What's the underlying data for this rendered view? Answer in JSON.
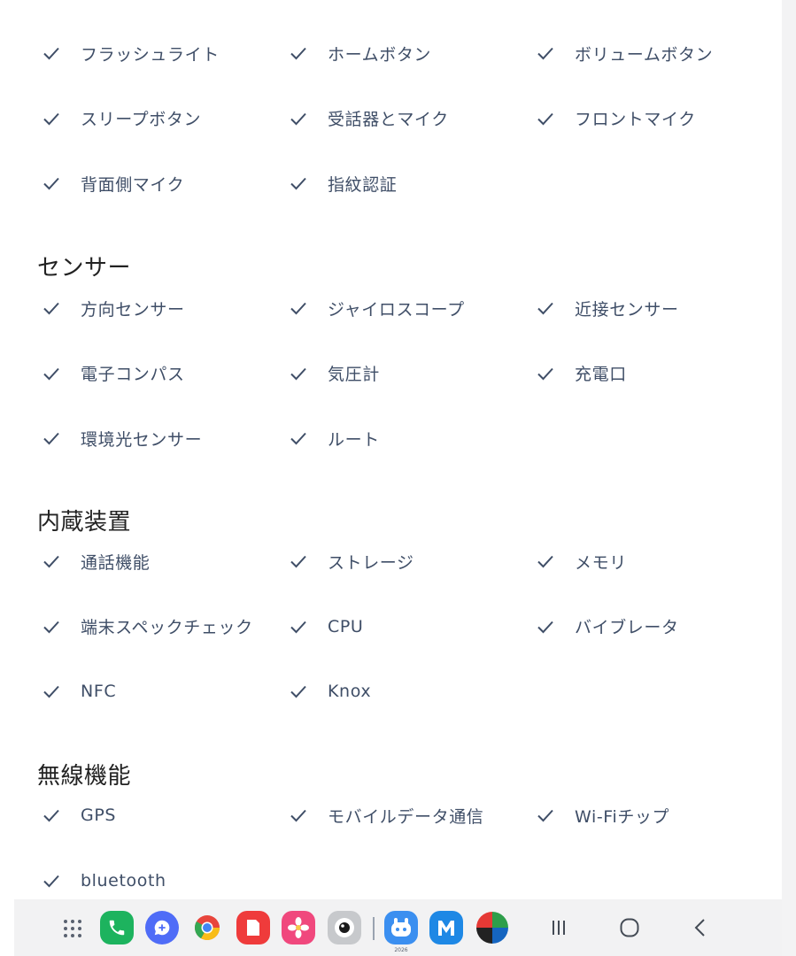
{
  "colors": {
    "accent": "#3f4e67",
    "heading": "#222222",
    "dock_bg": "#f2f2f3"
  },
  "sections": [
    {
      "title": "",
      "items": [
        "フラッシュライト",
        "ホームボタン",
        "ボリュームボタン",
        "スリープボタン",
        "受話器とマイク",
        "フロントマイク",
        "背面側マイク",
        "指紋認証"
      ]
    },
    {
      "title": "センサー",
      "items": [
        "方向センサー",
        "ジャイロスコープ",
        "近接センサー",
        "電子コンパス",
        "気圧計",
        "充電口",
        "環境光センサー",
        "ルート"
      ]
    },
    {
      "title": "内蔵装置",
      "items": [
        "通話機能",
        "ストレージ",
        "メモリ",
        "端末スペックチェック",
        "CPU",
        "バイブレータ",
        "NFC",
        "Knox"
      ]
    },
    {
      "title": "無線機能",
      "items": [
        "GPS",
        "モバイルデータ通信",
        "Wi-Fiチップ",
        "bluetooth"
      ]
    }
  ],
  "check_icon": "checkmark-icon",
  "dock": {
    "apps": [
      {
        "name": "app-drawer-icon",
        "color": "#5a6270"
      },
      {
        "name": "phone-app-icon",
        "color": "#1db35e"
      },
      {
        "name": "messages-app-icon",
        "color": "#4f6cf7"
      },
      {
        "name": "chrome-app-icon",
        "color": "#e8453c"
      },
      {
        "name": "notes-app-icon",
        "color": "#ef3b3b"
      },
      {
        "name": "gallery-app-icon",
        "color": "#f0487d"
      },
      {
        "name": "camera-app-icon",
        "color": "#c7c9cc"
      },
      {
        "name": "mascot-app-icon",
        "color": "#3b8ff0"
      },
      {
        "name": "m-app-icon",
        "color": "#1e88e5"
      },
      {
        "name": "multicolor-app-icon",
        "color": "#222222"
      }
    ],
    "mascot_caption": "2026",
    "nav": [
      "recent-apps-icon",
      "home-icon",
      "back-icon"
    ]
  }
}
